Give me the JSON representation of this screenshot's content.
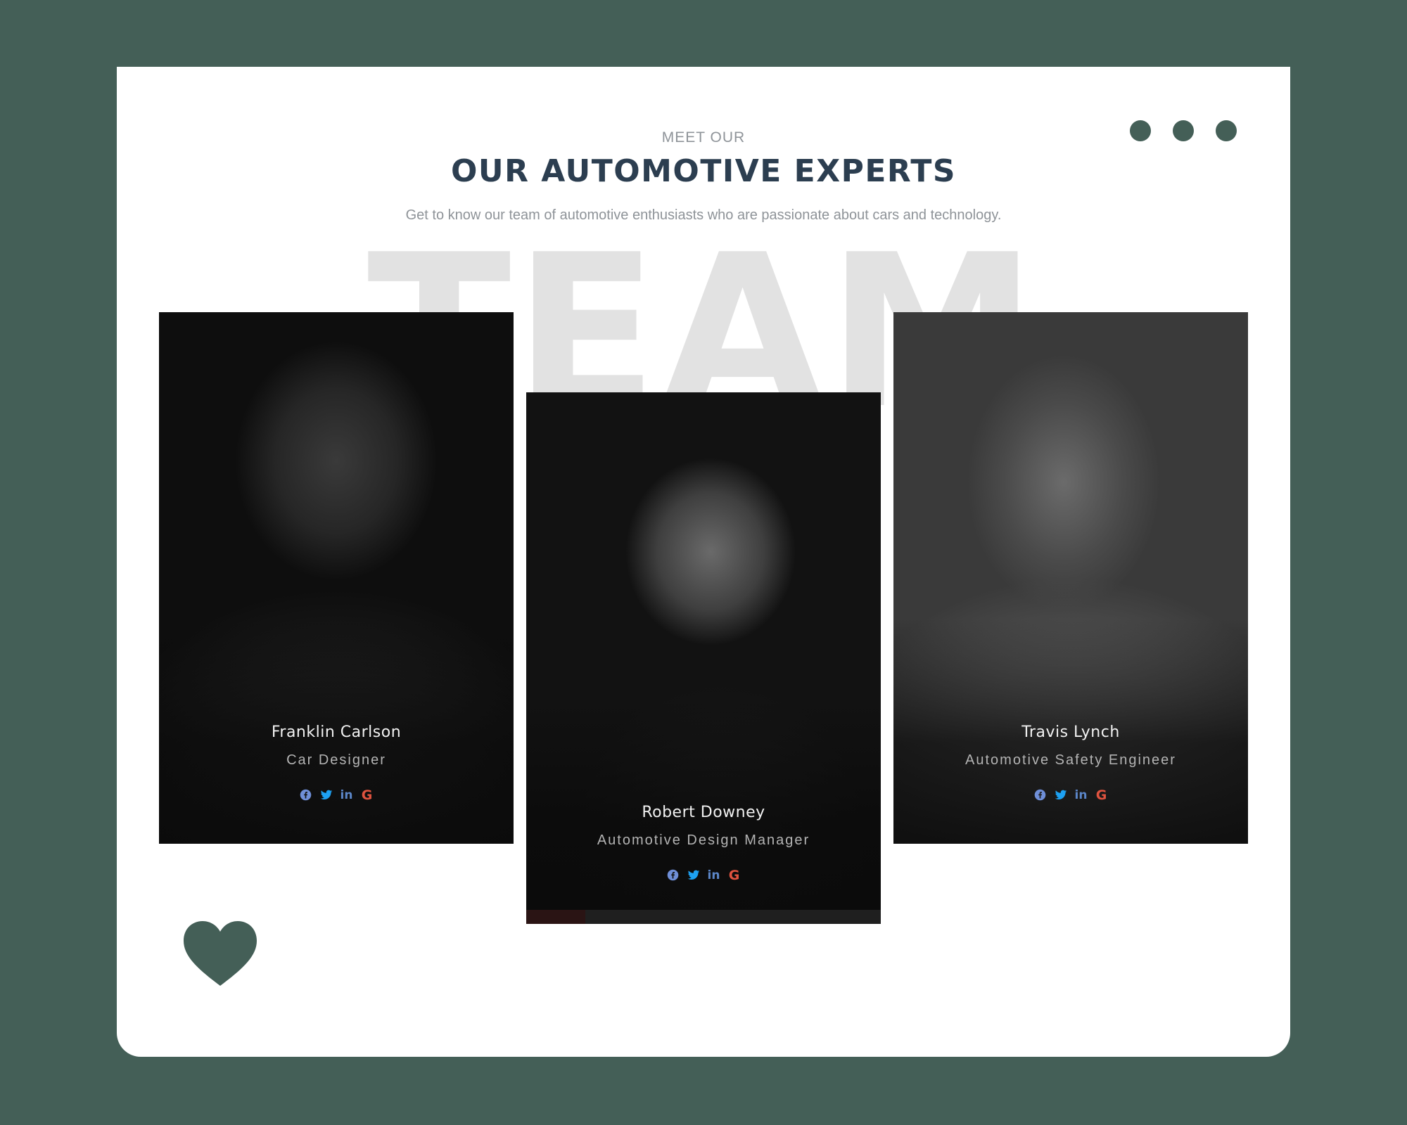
{
  "window": {
    "controls": [
      "dot",
      "dot",
      "dot"
    ]
  },
  "header": {
    "eyebrow": "MEET OUR",
    "title": "OUR AUTOMOTIVE EXPERTS",
    "subtitle": "Get to know our team of automotive enthusiasts who are passionate about cars and technology."
  },
  "watermark": "TEAM",
  "team": [
    {
      "name": "Franklin Carlson",
      "role": "Car Designer",
      "socials": [
        "facebook-icon",
        "twitter-icon",
        "linkedin-icon",
        "google-icon"
      ]
    },
    {
      "name": "Robert Downey",
      "role": "Automotive Design Manager",
      "socials": [
        "facebook-icon",
        "twitter-icon",
        "linkedin-icon",
        "google-icon"
      ]
    },
    {
      "name": "Travis Lynch",
      "role": "Automotive Safety Engineer",
      "socials": [
        "facebook-icon",
        "twitter-icon",
        "linkedin-icon",
        "google-icon"
      ]
    }
  ],
  "colors": {
    "background": "#445f57",
    "title": "#2c3e50",
    "facebook": "#6f8fd8",
    "twitter": "#1da1f2",
    "linkedin": "#5b86c8",
    "google": "#e0533f",
    "watermark": "#e2e2e2"
  },
  "decor": {
    "heart": "heart-icon"
  }
}
